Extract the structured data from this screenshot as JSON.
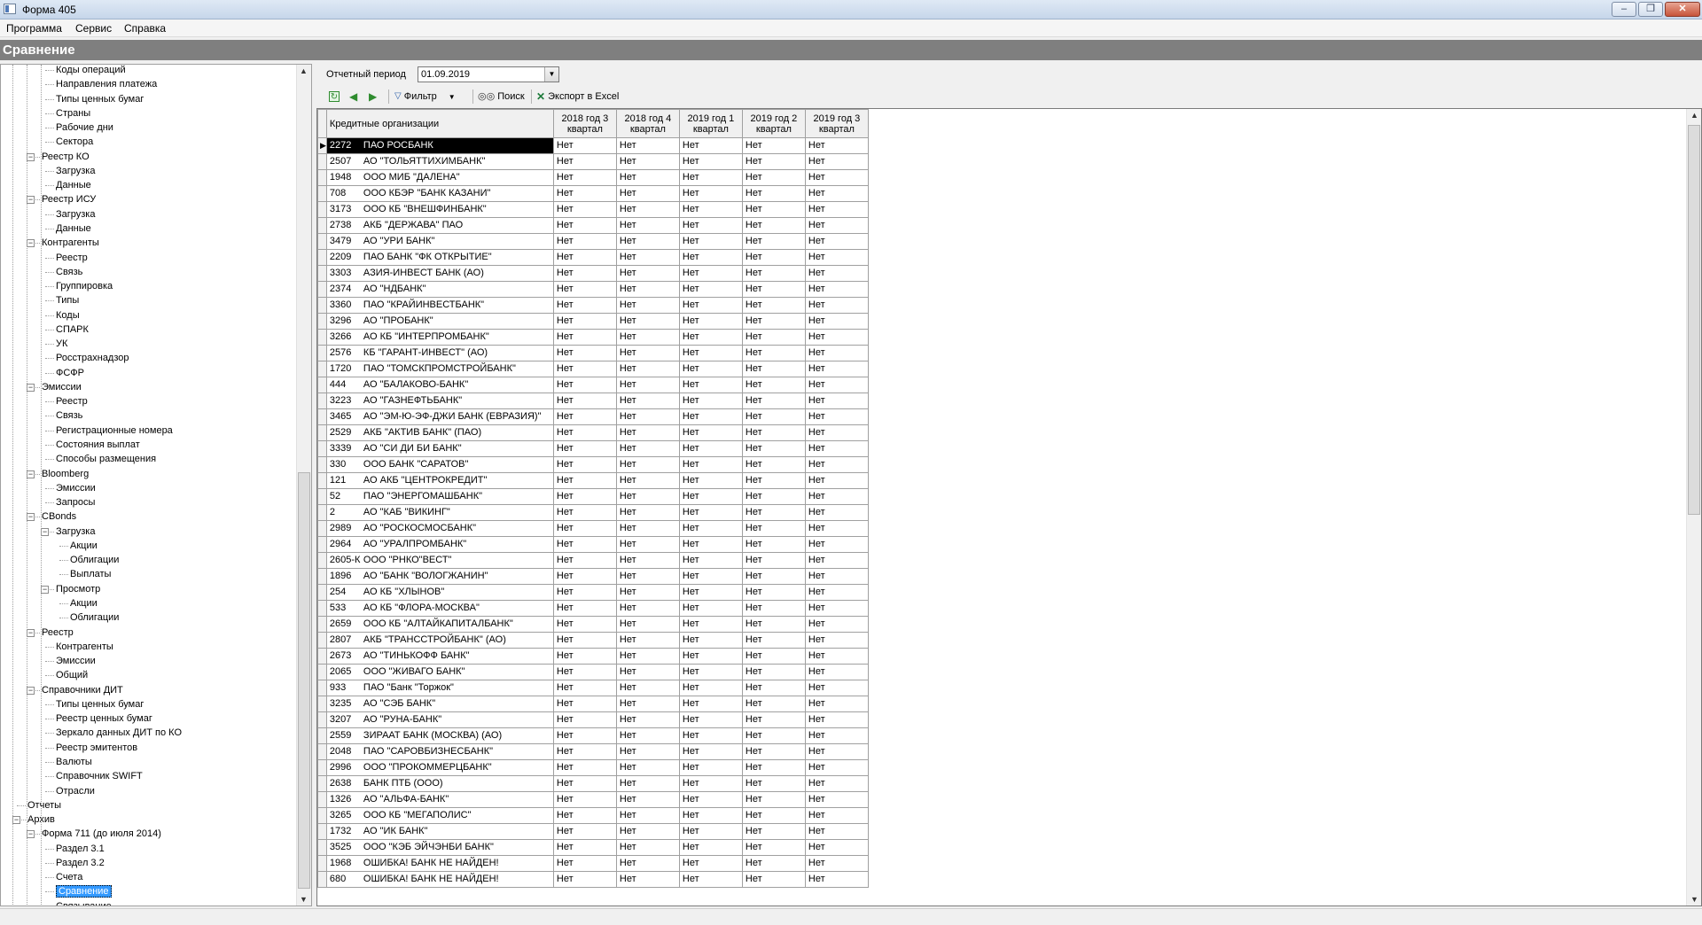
{
  "window": {
    "title": "Форма 405",
    "min": "–",
    "max": "❐",
    "close": "✕"
  },
  "menu": [
    "Программа",
    "Сервис",
    "Справка"
  ],
  "caption": "Сравнение",
  "tree": {
    "items": [
      {
        "label": "Коды операций",
        "level": 2,
        "exp": ""
      },
      {
        "label": "Направления платежа",
        "level": 2,
        "exp": ""
      },
      {
        "label": "Типы ценных бумаг",
        "level": 2,
        "exp": ""
      },
      {
        "label": "Страны",
        "level": 2,
        "exp": ""
      },
      {
        "label": "Рабочие дни",
        "level": 2,
        "exp": ""
      },
      {
        "label": "Сектора",
        "level": 2,
        "exp": ""
      },
      {
        "label": "Реестр КО",
        "level": 1,
        "exp": "-"
      },
      {
        "label": "Загрузка",
        "level": 2,
        "exp": ""
      },
      {
        "label": "Данные",
        "level": 2,
        "exp": ""
      },
      {
        "label": "Реестр ИСУ",
        "level": 1,
        "exp": "-"
      },
      {
        "label": "Загрузка",
        "level": 2,
        "exp": ""
      },
      {
        "label": "Данные",
        "level": 2,
        "exp": ""
      },
      {
        "label": "Контрагенты",
        "level": 1,
        "exp": "-"
      },
      {
        "label": "Реестр",
        "level": 2,
        "exp": ""
      },
      {
        "label": "Связь",
        "level": 2,
        "exp": ""
      },
      {
        "label": "Группировка",
        "level": 2,
        "exp": ""
      },
      {
        "label": "Типы",
        "level": 2,
        "exp": ""
      },
      {
        "label": "Коды",
        "level": 2,
        "exp": ""
      },
      {
        "label": "СПАРК",
        "level": 2,
        "exp": ""
      },
      {
        "label": "УК",
        "level": 2,
        "exp": ""
      },
      {
        "label": "Росстрахнадзор",
        "level": 2,
        "exp": ""
      },
      {
        "label": "ФСФР",
        "level": 2,
        "exp": ""
      },
      {
        "label": "Эмиссии",
        "level": 1,
        "exp": "-"
      },
      {
        "label": "Реестр",
        "level": 2,
        "exp": ""
      },
      {
        "label": "Связь",
        "level": 2,
        "exp": ""
      },
      {
        "label": "Регистрационные номера",
        "level": 2,
        "exp": ""
      },
      {
        "label": "Состояния выплат",
        "level": 2,
        "exp": ""
      },
      {
        "label": "Способы размещения",
        "level": 2,
        "exp": ""
      },
      {
        "label": "Bloomberg",
        "level": 1,
        "exp": "-"
      },
      {
        "label": "Эмиссии",
        "level": 2,
        "exp": ""
      },
      {
        "label": "Запросы",
        "level": 2,
        "exp": ""
      },
      {
        "label": "CBonds",
        "level": 1,
        "exp": "-"
      },
      {
        "label": "Загрузка",
        "level": 2,
        "exp": "-"
      },
      {
        "label": "Акции",
        "level": 3,
        "exp": ""
      },
      {
        "label": "Облигации",
        "level": 3,
        "exp": ""
      },
      {
        "label": "Выплаты",
        "level": 3,
        "exp": ""
      },
      {
        "label": "Просмотр",
        "level": 2,
        "exp": "-"
      },
      {
        "label": "Акции",
        "level": 3,
        "exp": ""
      },
      {
        "label": "Облигации",
        "level": 3,
        "exp": ""
      },
      {
        "label": "Реестр",
        "level": 1,
        "exp": "-"
      },
      {
        "label": "Контрагенты",
        "level": 2,
        "exp": ""
      },
      {
        "label": "Эмиссии",
        "level": 2,
        "exp": ""
      },
      {
        "label": "Общий",
        "level": 2,
        "exp": ""
      },
      {
        "label": "Справочники ДИТ",
        "level": 1,
        "exp": "-"
      },
      {
        "label": "Типы ценных бумаг",
        "level": 2,
        "exp": ""
      },
      {
        "label": "Реестр ценных бумаг",
        "level": 2,
        "exp": ""
      },
      {
        "label": "Зеркало данных ДИТ по КО",
        "level": 2,
        "exp": ""
      },
      {
        "label": "Реестр эмитентов",
        "level": 2,
        "exp": ""
      },
      {
        "label": "Валюты",
        "level": 2,
        "exp": ""
      },
      {
        "label": "Справочник SWIFT",
        "level": 2,
        "exp": ""
      },
      {
        "label": "Отрасли",
        "level": 2,
        "exp": ""
      },
      {
        "label": "Отчеты",
        "level": 0,
        "exp": ""
      },
      {
        "label": "Архив",
        "level": 0,
        "exp": "-"
      },
      {
        "label": "Форма 711 (до июля 2014)",
        "level": 1,
        "exp": "-"
      },
      {
        "label": "Раздел 3.1",
        "level": 2,
        "exp": ""
      },
      {
        "label": "Раздел 3.2",
        "level": 2,
        "exp": ""
      },
      {
        "label": "Счета",
        "level": 2,
        "exp": ""
      },
      {
        "label": "Сравнение",
        "level": 2,
        "exp": "",
        "selected": true
      },
      {
        "label": "Связывание",
        "level": 2,
        "exp": ""
      }
    ]
  },
  "period": {
    "label": "Отчетный период",
    "value": "01.09.2019"
  },
  "toolbar": {
    "filter": "Фильтр",
    "search": "Поиск",
    "export": "Экспорт в Excel"
  },
  "grid": {
    "org_header": "Кредитные организации",
    "period_headers": [
      [
        "2018 год 3",
        "квартал"
      ],
      [
        "2018 год 4",
        "квартал"
      ],
      [
        "2019 год 1",
        "квартал"
      ],
      [
        "2019 год 2",
        "квартал"
      ],
      [
        "2019 год 3",
        "квартал"
      ]
    ],
    "cell_value": "Нет",
    "rows": [
      [
        "2272",
        "ПАО РОСБАНК"
      ],
      [
        "2507",
        "АО \"ТОЛЬЯТТИХИМБАНК\""
      ],
      [
        "1948",
        "ООО МИБ \"ДАЛЕНА\""
      ],
      [
        "708",
        "ООО КБЭР \"БАНК КАЗАНИ\""
      ],
      [
        "3173",
        "ООО КБ \"ВНЕШФИНБАНК\""
      ],
      [
        "2738",
        "АКБ \"ДЕРЖАВА\" ПАО"
      ],
      [
        "3479",
        "АО \"УРИ БАНК\""
      ],
      [
        "2209",
        "ПАО БАНК \"ФК ОТКРЫТИЕ\""
      ],
      [
        "3303",
        "АЗИЯ-ИНВЕСТ БАНК (АО)"
      ],
      [
        "2374",
        "АО \"НДБАНК\""
      ],
      [
        "3360",
        "ПАО \"КРАЙИНВЕСТБАНК\""
      ],
      [
        "3296",
        "АО \"ПРОБАНК\""
      ],
      [
        "3266",
        "АО КБ \"ИНТЕРПРОМБАНК\""
      ],
      [
        "2576",
        "КБ \"ГАРАНТ-ИНВЕСТ\" (АО)"
      ],
      [
        "1720",
        "ПАО \"ТОМСКПРОМСТРОЙБАНК\""
      ],
      [
        "444",
        "АО \"БАЛАКОВО-БАНК\""
      ],
      [
        "3223",
        "АО \"ГАЗНЕФТЬБАНК\""
      ],
      [
        "3465",
        "АО \"ЭМ-Ю-ЭФ-ДЖИ БАНК (ЕВРАЗИЯ)\""
      ],
      [
        "2529",
        "АКБ \"АКТИВ БАНК\" (ПАО)"
      ],
      [
        "3339",
        "АО \"СИ ДИ БИ БАНК\""
      ],
      [
        "330",
        "ООО БАНК \"САРАТОВ\""
      ],
      [
        "121",
        "АО АКБ \"ЦЕНТРОКРЕДИТ\""
      ],
      [
        "52",
        "ПАО \"ЭНЕРГОМАШБАНК\""
      ],
      [
        "2",
        "АО \"КАБ \"ВИКИНГ\""
      ],
      [
        "2989",
        "АО \"РОСКОСМОСБАНК\""
      ],
      [
        "2964",
        "АО \"УРАЛПРОМБАНК\""
      ],
      [
        "2605-К",
        "ООО \"РНКО\"ВЕСТ\""
      ],
      [
        "1896",
        "АО \"БАНК \"ВОЛОГЖАНИН\""
      ],
      [
        "254",
        "АО КБ \"ХЛЫНОВ\""
      ],
      [
        "533",
        "АО КБ \"ФЛОРА-МОСКВА\""
      ],
      [
        "2659",
        "ООО КБ \"АЛТАЙКАПИТАЛБАНК\""
      ],
      [
        "2807",
        "АКБ \"ТРАНССТРОЙБАНК\" (АО)"
      ],
      [
        "2673",
        "АО \"ТИНЬКОФФ БАНК\""
      ],
      [
        "2065",
        "ООО \"ЖИВАГО БАНК\""
      ],
      [
        "933",
        "ПАО \"Банк \"Торжок\""
      ],
      [
        "3235",
        "АО \"СЭБ БАНК\""
      ],
      [
        "3207",
        "АО \"РУНА-БАНК\""
      ],
      [
        "2559",
        "ЗИРААТ БАНК (МОСКВА) (АО)"
      ],
      [
        "2048",
        "ПАО \"САРОВБИЗНЕСБАНК\""
      ],
      [
        "2996",
        "ООО \"ПРОКОММЕРЦБАНК\""
      ],
      [
        "2638",
        "БАНК ПТБ (ООО)"
      ],
      [
        "1326",
        "АО \"АЛЬФА-БАНК\""
      ],
      [
        "3265",
        "ООО КБ \"МЕГАПОЛИС\""
      ],
      [
        "1732",
        "АО \"ИК БАНК\""
      ],
      [
        "3525",
        "ООО \"КЭБ ЭЙЧЭНБИ БАНК\""
      ],
      [
        "1968",
        "ОШИБКА! БАНК НЕ НАЙДЕН!"
      ],
      [
        "680",
        "ОШИБКА! БАНК НЕ НАЙДЕН!"
      ]
    ]
  }
}
